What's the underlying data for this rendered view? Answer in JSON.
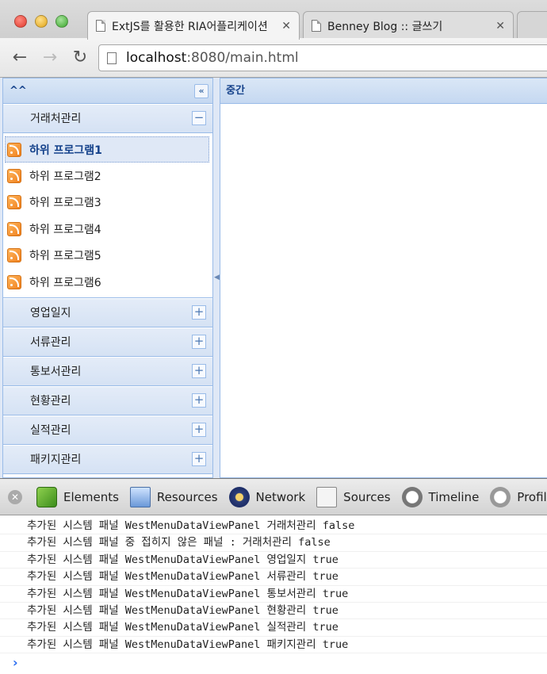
{
  "browser": {
    "tabs": [
      {
        "title": "ExtJS를 활용한 RIA어플리케이션",
        "close": "✕"
      },
      {
        "title": "Benney Blog :: 글쓰기",
        "close": "✕"
      }
    ],
    "url_host": "localhost",
    "url_rest": ":8080/main.html"
  },
  "west": {
    "title": "^^",
    "collapse_glyph": "«",
    "groups": [
      {
        "label": "거래처관리",
        "tool": "−"
      },
      {
        "label": "영업일지",
        "tool": "+"
      },
      {
        "label": "서류관리",
        "tool": "+"
      },
      {
        "label": "통보서관리",
        "tool": "+"
      },
      {
        "label": "현황관리",
        "tool": "+"
      },
      {
        "label": "실적관리",
        "tool": "+"
      },
      {
        "label": "패키지관리",
        "tool": "+"
      }
    ],
    "items": [
      "하위 프로그램1",
      "하위 프로그램2",
      "하위 프로그램3",
      "하위 프로그램4",
      "하위 프로그램5",
      "하위 프로그램6"
    ]
  },
  "center": {
    "title": "중간"
  },
  "devtools": {
    "tabs": [
      "Elements",
      "Resources",
      "Network",
      "Sources",
      "Timeline",
      "Profil"
    ],
    "console": [
      "추가된 시스템 패널 WestMenuDataViewPanel 거래처관리 false",
      "추가된 시스템 패널 중 접히지 않은 패널 : 거래처관리 false",
      "추가된 시스템 패널 WestMenuDataViewPanel 영업일지 true",
      "추가된 시스템 패널 WestMenuDataViewPanel 서류관리 true",
      "추가된 시스템 패널 WestMenuDataViewPanel 통보서관리 true",
      "추가된 시스템 패널 WestMenuDataViewPanel 현황관리 true",
      "추가된 시스템 패널 WestMenuDataViewPanel 실적관리 true",
      "추가된 시스템 패널 WestMenuDataViewPanel 패키지관리 true"
    ],
    "prompt": "›"
  }
}
